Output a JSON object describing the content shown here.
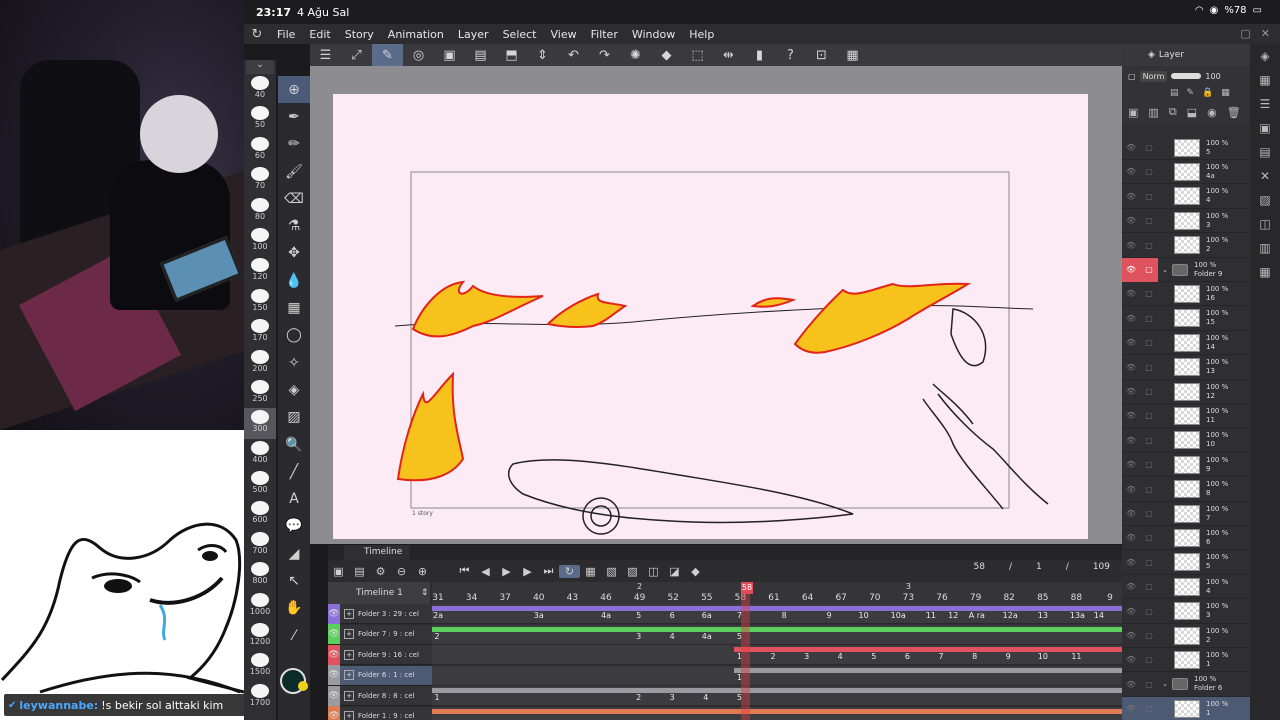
{
  "status": {
    "time": "23:17",
    "date": "4 Ağu Sal",
    "battery": "%78"
  },
  "menu": [
    "File",
    "Edit",
    "Story",
    "Animation",
    "Layer",
    "Select",
    "View",
    "Filter",
    "Window",
    "Help"
  ],
  "chat": {
    "user": "leywannabe:",
    "message": "!s bekir sol alttaki kim"
  },
  "brush_sizes": [
    "40",
    "50",
    "60",
    "70",
    "80",
    "100",
    "120",
    "150",
    "170",
    "200",
    "250",
    "300",
    "400",
    "500",
    "600",
    "700",
    "800",
    "1000",
    "1200",
    "1500",
    "1700"
  ],
  "selected_brush_size": "300",
  "canvas": {
    "story_label": "1 story"
  },
  "timeline": {
    "tab_label": "Timeline",
    "name": "Timeline 1",
    "current_frame": "58",
    "page": "1",
    "total_frames": "109",
    "frame_numbers": [
      "31",
      "34",
      "37",
      "40",
      "43",
      "46",
      "49",
      "52",
      "55",
      "58",
      "61",
      "64",
      "67",
      "70",
      "73",
      "76",
      "79",
      "82",
      "85",
      "88",
      "9"
    ],
    "section_markers": [
      {
        "label": "2",
        "at": "49"
      },
      {
        "label": "3",
        "at": "73"
      }
    ],
    "rows": [
      {
        "label": "Folder 3 : 29 : cel",
        "color": "#8a6fd8",
        "cels": [
          {
            "t": "2a",
            "f": 31
          },
          {
            "t": "3a",
            "f": 40
          },
          {
            "t": "4a",
            "f": 46
          },
          {
            "t": "5",
            "f": 49
          },
          {
            "t": "6",
            "f": 52
          },
          {
            "t": "6a",
            "f": 55
          },
          {
            "t": "7",
            "f": 58
          },
          {
            "t": "8",
            "f": 62
          },
          {
            "t": "9",
            "f": 66
          },
          {
            "t": "10",
            "f": 69
          },
          {
            "t": "10a",
            "f": 72
          },
          {
            "t": "11",
            "f": 75
          },
          {
            "t": "12",
            "f": 77
          },
          {
            "t": "A ra",
            "f": 79
          },
          {
            "t": "12a",
            "f": 82
          },
          {
            "t": "13",
            "f": 85
          },
          {
            "t": "13a",
            "f": 88
          },
          {
            "t": "14",
            "f": 90
          }
        ]
      },
      {
        "label": "Folder 7 : 9 : cel",
        "color": "#5ccf5c",
        "cels": [
          {
            "t": "2",
            "f": 31
          },
          {
            "t": "3",
            "f": 49
          },
          {
            "t": "4",
            "f": 52
          },
          {
            "t": "4a",
            "f": 55
          },
          {
            "t": "5",
            "f": 58
          }
        ]
      },
      {
        "label": "Folder 9 : 16 : cel",
        "color": "#e0525e",
        "cels": [
          {
            "t": "1",
            "f": 58
          },
          {
            "t": "2",
            "f": 61
          },
          {
            "t": "3",
            "f": 64
          },
          {
            "t": "4",
            "f": 67
          },
          {
            "t": "5",
            "f": 70
          },
          {
            "t": "6",
            "f": 73
          },
          {
            "t": "7",
            "f": 76
          },
          {
            "t": "8",
            "f": 79
          },
          {
            "t": "9",
            "f": 82
          },
          {
            "t": "10",
            "f": 85
          },
          {
            "t": "11",
            "f": 88
          }
        ]
      },
      {
        "label": "Folder 6 : 1 : cel",
        "color": "#9a9aa0",
        "cels": [
          {
            "t": "1",
            "f": 58
          }
        ]
      },
      {
        "label": "Folder 8 : 8 : cel",
        "color": "#9a9aa0",
        "cels": [
          {
            "t": "1",
            "f": 31
          },
          {
            "t": "2",
            "f": 49
          },
          {
            "t": "3",
            "f": 52
          },
          {
            "t": "4",
            "f": 55
          },
          {
            "t": "5",
            "f": 58
          }
        ]
      },
      {
        "label": "Folder 1 : 9 : cel",
        "color": "#e07a50",
        "cels": []
      }
    ]
  },
  "layer_panel": {
    "tab": "Layer",
    "blend_mode": "Norm",
    "opacity": "100",
    "layers": [
      {
        "pct": "100 %",
        "name": "5"
      },
      {
        "pct": "100 %",
        "name": "4a"
      },
      {
        "pct": "100 %",
        "name": "4"
      },
      {
        "pct": "100 %",
        "name": "3"
      },
      {
        "pct": "100 %",
        "name": "2"
      },
      {
        "pct": "100 %",
        "name": "Folder 9",
        "folder": true,
        "red": true
      },
      {
        "pct": "100 %",
        "name": "16"
      },
      {
        "pct": "100 %",
        "name": "15"
      },
      {
        "pct": "100 %",
        "name": "14"
      },
      {
        "pct": "100 %",
        "name": "13"
      },
      {
        "pct": "100 %",
        "name": "12"
      },
      {
        "pct": "100 %",
        "name": "11"
      },
      {
        "pct": "100 %",
        "name": "10"
      },
      {
        "pct": "100 %",
        "name": "9"
      },
      {
        "pct": "100 %",
        "name": "8"
      },
      {
        "pct": "100 %",
        "name": "7"
      },
      {
        "pct": "100 %",
        "name": "6"
      },
      {
        "pct": "100 %",
        "name": "5"
      },
      {
        "pct": "100 %",
        "name": "4"
      },
      {
        "pct": "100 %",
        "name": "3"
      },
      {
        "pct": "100 %",
        "name": "2"
      },
      {
        "pct": "100 %",
        "name": "1"
      },
      {
        "pct": "100 %",
        "name": "Folder 6",
        "folder": true
      },
      {
        "pct": "100 %",
        "name": "1",
        "selected": true
      }
    ]
  },
  "colors": {
    "accent_selected": "#5a6c8a",
    "playhead": "#e24c5a",
    "paper": "#fcebf4"
  }
}
